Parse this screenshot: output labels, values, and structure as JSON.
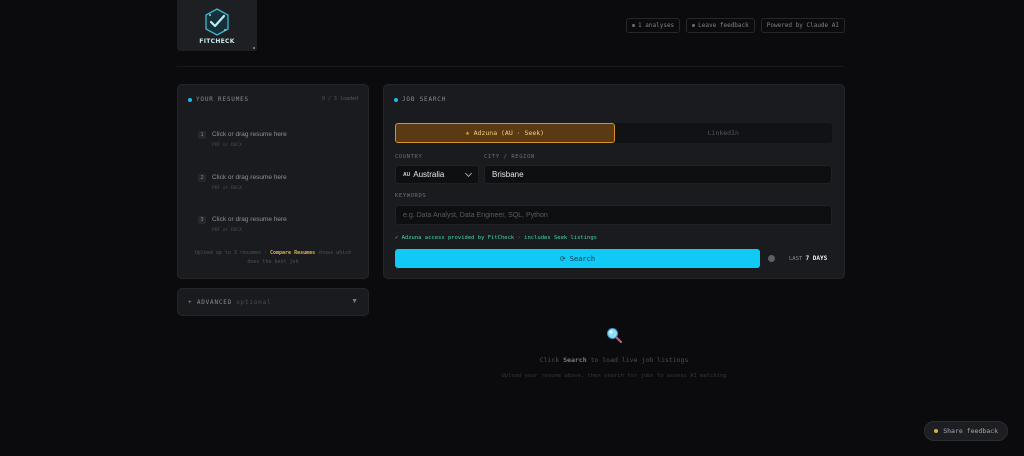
{
  "header": {
    "logo_text": "FITCHECK",
    "links": [
      {
        "label": "1 analyses"
      },
      {
        "label": "Leave feedback"
      },
      {
        "label": "Powered by Claude AI"
      }
    ]
  },
  "resumes": {
    "title": "YOUR RESUMES",
    "count": "0 / 3 loaded",
    "slots": [
      {
        "num": "1",
        "label": "Click or drag resume here",
        "sub": "PDF or DOCX"
      },
      {
        "num": "2",
        "label": "Click or drag resume here",
        "sub": "PDF or DOCX"
      },
      {
        "num": "3",
        "label": "Click or drag resume here",
        "sub": "PDF or DOCX"
      }
    ],
    "note_pre": "Upload up to 3 resumes ·",
    "note_link": "Compare Resumes",
    "note_post": "shows which",
    "note_line2": "does the best job"
  },
  "advanced": {
    "title": "+ ADVANCED",
    "optional": "optional"
  },
  "job_search": {
    "title": "JOB SEARCH",
    "tabs": [
      {
        "label": "Adzuna (AU · Seek)",
        "active": true
      },
      {
        "label": "LinkedIn",
        "active": false
      }
    ],
    "country_label": "COUNTRY",
    "country_code": "AU",
    "country_value": "Australia",
    "city_label": "CITY / REGION",
    "city_value": "Brisbane",
    "keywords_label": "KEYWORDS",
    "keywords_placeholder": "e.g. Data Analyst, Data Engineer, SQL, Python",
    "provider_note": "✓ Adzuna access provided by FitCheck · includes Seek listings",
    "search_label": "Search",
    "last_label": "LAST",
    "days_label": "7 DAYS"
  },
  "empty_state": {
    "line1_pre": "Click",
    "line1_strong": "Search",
    "line1_post": "to load live job listings",
    "line2": "Upload your resume above, then search for jobs to assess AI matching"
  },
  "share_feedback": "Share feedback",
  "colors": {
    "accent": "#11c9f5",
    "adzuna_orange": "#d6912e",
    "note_green": "#3fd7a8",
    "compare_gold": "#e2b04a"
  }
}
